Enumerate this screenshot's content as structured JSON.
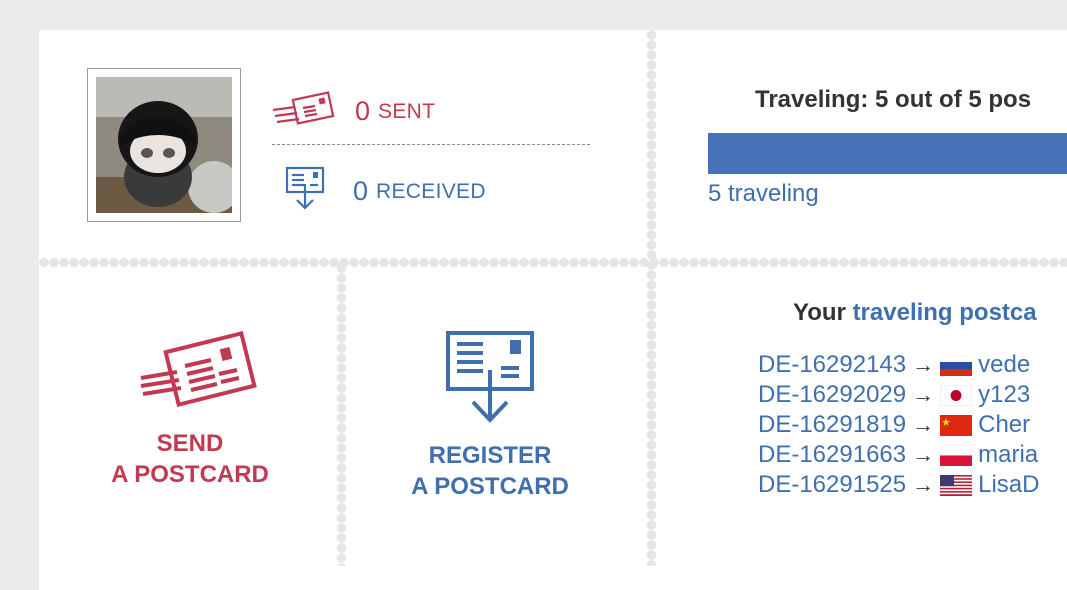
{
  "stats": {
    "sent_count": "0",
    "sent_label": "SENT",
    "received_count": "0",
    "received_label": "RECEIVED"
  },
  "traveling": {
    "title": "Traveling: 5 out of 5 pos",
    "progress_fraction": 1.0,
    "count_text": "5 traveling"
  },
  "actions": {
    "send_line1": "SEND",
    "send_line2": "A POSTCARD",
    "register_line1": "REGISTER",
    "register_line2": "A POSTCARD"
  },
  "postcards": {
    "heading_prefix": "Your ",
    "heading_link": "traveling postca",
    "items": [
      {
        "id": "DE-16292143",
        "arrow": "→",
        "country_flag": "russia",
        "user": "vede"
      },
      {
        "id": "DE-16292029",
        "arrow": "→",
        "country_flag": "japan",
        "user": "y123"
      },
      {
        "id": "DE-16291819",
        "arrow": "→",
        "country_flag": "china",
        "user": "Cher"
      },
      {
        "id": "DE-16291663",
        "arrow": "→",
        "country_flag": "poland",
        "user": "maria"
      },
      {
        "id": "DE-16291525",
        "arrow": "→",
        "country_flag": "usa",
        "user": "LisaD"
      }
    ]
  },
  "colors": {
    "red": "#c13a52",
    "blue": "#3f6fae",
    "bar": "#4672b7"
  }
}
